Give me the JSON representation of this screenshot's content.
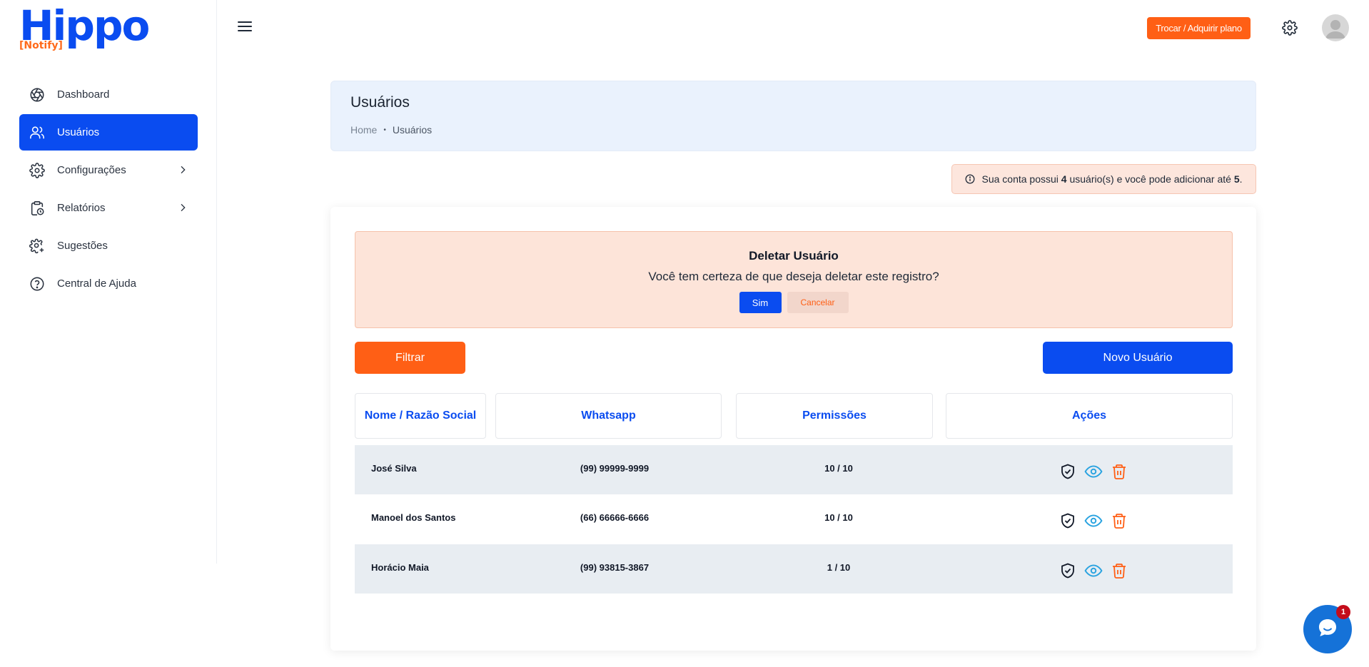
{
  "brand": {
    "name": "Hippo",
    "sub": "[Notify]"
  },
  "sidebar": {
    "items": [
      {
        "label": "Dashboard",
        "icon": "aperture-icon",
        "active": false,
        "chevron": false
      },
      {
        "label": "Usuários",
        "icon": "users-icon",
        "active": true,
        "chevron": false
      },
      {
        "label": "Configurações",
        "icon": "gear-icon",
        "active": false,
        "chevron": true
      },
      {
        "label": "Relatórios",
        "icon": "clipboard-clock-icon",
        "active": false,
        "chevron": true
      },
      {
        "label": "Sugestões",
        "icon": "gear-plus-icon",
        "active": false,
        "chevron": false
      },
      {
        "label": "Central de Ajuda",
        "icon": "help-circle-icon",
        "active": false,
        "chevron": false
      }
    ]
  },
  "topbar": {
    "plan_button": "Trocar / Adquirir plano"
  },
  "header": {
    "title": "Usuários",
    "breadcrumb": [
      "Home",
      "Usuários"
    ],
    "separator": "•"
  },
  "info": {
    "prefix": "Sua conta possui ",
    "count": "4",
    "middle": " usuário(s) e você pode adicionar até ",
    "limit": "5",
    "suffix": "."
  },
  "confirm": {
    "title": "Deletar Usuário",
    "message": "Você tem certeza de que deseja deletar este registro?",
    "yes": "Sim",
    "cancel": "Cancelar"
  },
  "actions": {
    "filter": "Filtrar",
    "new_user": "Novo Usuário"
  },
  "table": {
    "columns": [
      "Nome / Razão Social",
      "Whatsapp",
      "Permissões",
      "Ações"
    ],
    "rows": [
      {
        "name": "José Silva",
        "whatsapp": "(99) 99999-9999",
        "permissions": "10 / 10"
      },
      {
        "name": "Manoel dos Santos",
        "whatsapp": "(66) 66666-6666",
        "permissions": "10 / 10"
      },
      {
        "name": "Horácio Maia",
        "whatsapp": "(99) 93815-3867",
        "permissions": "1 / 10"
      }
    ]
  },
  "chat": {
    "badge": "1"
  },
  "colors": {
    "primary": "#0a4cf0",
    "accent": "#ff5f15",
    "header_bg": "#eaf2fd",
    "alert_bg": "#fde4d9"
  }
}
